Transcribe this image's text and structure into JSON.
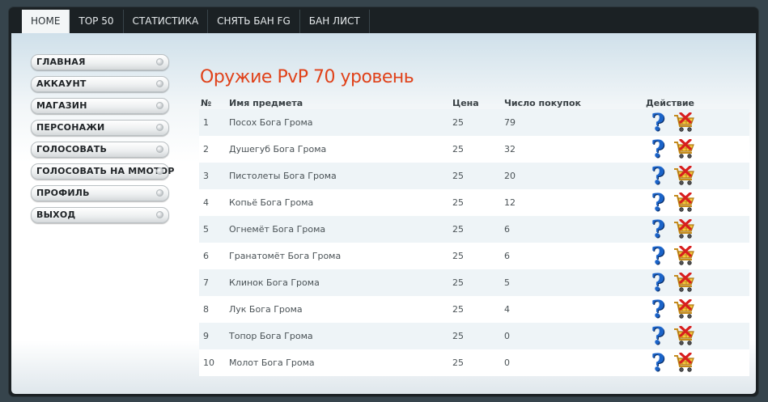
{
  "topnav": {
    "tabs": [
      {
        "label": "HOME",
        "active": true
      },
      {
        "label": "TOP 50",
        "active": false
      },
      {
        "label": "СТАТИСТИКА",
        "active": false
      },
      {
        "label": "СНЯТЬ БАН FG",
        "active": false
      },
      {
        "label": "БАН ЛИСТ",
        "active": false
      }
    ]
  },
  "sidebar": {
    "items": [
      {
        "label": "ГЛАВНАЯ"
      },
      {
        "label": "АККАУНТ"
      },
      {
        "label": "МАГАЗИН"
      },
      {
        "label": "ПЕРСОНАЖИ"
      },
      {
        "label": "ГОЛОСОВАТЬ"
      },
      {
        "label": "ГОЛОСОВАТЬ НА ММОТОР"
      },
      {
        "label": "ПРОФИЛЬ"
      },
      {
        "label": "ВЫХОД"
      }
    ]
  },
  "main": {
    "title": "Оружие PvP 70 уровень",
    "columns": {
      "num": "№",
      "name": "Имя предмета",
      "price": "Цена",
      "buys": "Число покупок",
      "action": "Действие"
    },
    "rows": [
      {
        "num": "1",
        "name": "Посох Бога Грома",
        "price": "25",
        "buys": "79"
      },
      {
        "num": "2",
        "name": "Душегуб Бога Грома",
        "price": "25",
        "buys": "32"
      },
      {
        "num": "3",
        "name": "Пистолеты Бога Грома",
        "price": "25",
        "buys": "20"
      },
      {
        "num": "4",
        "name": "Копьё Бога Грома",
        "price": "25",
        "buys": "12"
      },
      {
        "num": "5",
        "name": "Огнемёт Бога Грома",
        "price": "25",
        "buys": "6"
      },
      {
        "num": "6",
        "name": "Гранатомёт Бога Грома",
        "price": "25",
        "buys": "6"
      },
      {
        "num": "7",
        "name": "Клинок Бога Грома",
        "price": "25",
        "buys": "5"
      },
      {
        "num": "8",
        "name": "Лук Бога Грома",
        "price": "25",
        "buys": "4"
      },
      {
        "num": "9",
        "name": "Топор Бога Грома",
        "price": "25",
        "buys": "0"
      },
      {
        "num": "10",
        "name": "Молот Бога Грома",
        "price": "25",
        "buys": "0"
      }
    ],
    "row_actions": [
      {
        "icon": "help-icon",
        "glyph": "?"
      },
      {
        "icon": "cart-remove-icon"
      }
    ]
  },
  "colors": {
    "title": "#e0421a",
    "help_icon": "#1a63c8",
    "cart_cross": "#d81e1e",
    "active_tab_bg": "#f3f6f7"
  }
}
